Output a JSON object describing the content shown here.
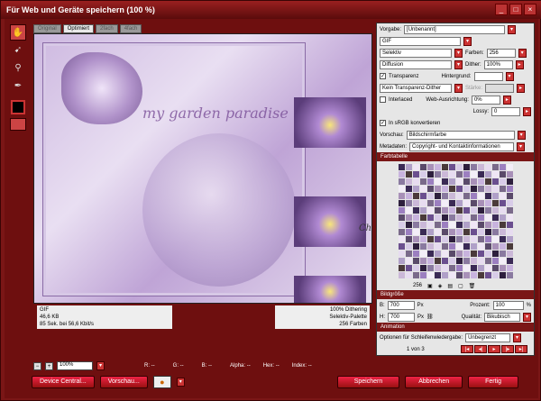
{
  "window": {
    "title": "Für Web und Geräte speichern (100 %)"
  },
  "tabs": [
    {
      "label": "Original"
    },
    {
      "label": "Optimiert"
    },
    {
      "label": "2fach"
    },
    {
      "label": "4fach"
    }
  ],
  "artwork": {
    "title_text": "my garden paradise",
    "signature": "Christa"
  },
  "info_left": {
    "format": "GIF",
    "size": "46,6 KB",
    "time": "85 Sek. bei 56,6 Kbit/s"
  },
  "info_right": {
    "dither": "100% Dithering",
    "palette": "Selektiv-Palette",
    "colors": "256 Farben"
  },
  "statusbar": {
    "zoom": "100%",
    "r": "R: --",
    "g": "G: --",
    "b": "B: --",
    "alpha": "Alpha: --",
    "hex": "Hex: --",
    "index": "Index: --"
  },
  "buttons": {
    "device_central": "Device Central...",
    "preview": "Vorschau...",
    "save": "Speichern",
    "cancel": "Abbrechen",
    "done": "Fertig"
  },
  "settings": {
    "preset_label": "Vorgabe:",
    "preset_value": "[Unbenannt]",
    "format": "GIF",
    "reduction": "Selektiv",
    "colors_label": "Farben:",
    "colors_value": "256",
    "dither_algo": "Diffusion",
    "dither_label": "Dither:",
    "dither_value": "100%",
    "transparency_label": "Transparenz",
    "matte_label": "Hintergrund:",
    "transparency_dither": "Kein Transparenz-Dither",
    "amount_label": "Stärke:",
    "interlaced_label": "Interlaced",
    "websnap_label": "Web-Ausrichtung:",
    "websnap_value": "0%",
    "lossy_label": "Lossy:",
    "lossy_value": "0",
    "srgb_label": "In sRGB konvertieren",
    "preview_label": "Vorschau:",
    "preview_value": "Bildschirmfarbe",
    "metadata_label": "Metadaten:",
    "metadata_value": "Copyright- und Kontaktinformationen"
  },
  "color_table": {
    "heading": "Farbtabelle",
    "count": "256"
  },
  "image_size": {
    "heading": "Bildgröße",
    "w_label": "B:",
    "w_value": "700",
    "h_label": "H:",
    "h_value": "700",
    "unit": "Px",
    "percent_label": "Prozent:",
    "percent_value": "100",
    "percent_unit": "%",
    "quality_label": "Qualität:",
    "quality_value": "Bikubisch"
  },
  "animation": {
    "heading": "Animation",
    "loop_label": "Optionen für Schleifenwiedergabe:",
    "loop_value": "Unbegrenzt",
    "frame": "1 von 3"
  },
  "colors": {
    "accent": "#c33333",
    "frame": "#7a1616"
  }
}
